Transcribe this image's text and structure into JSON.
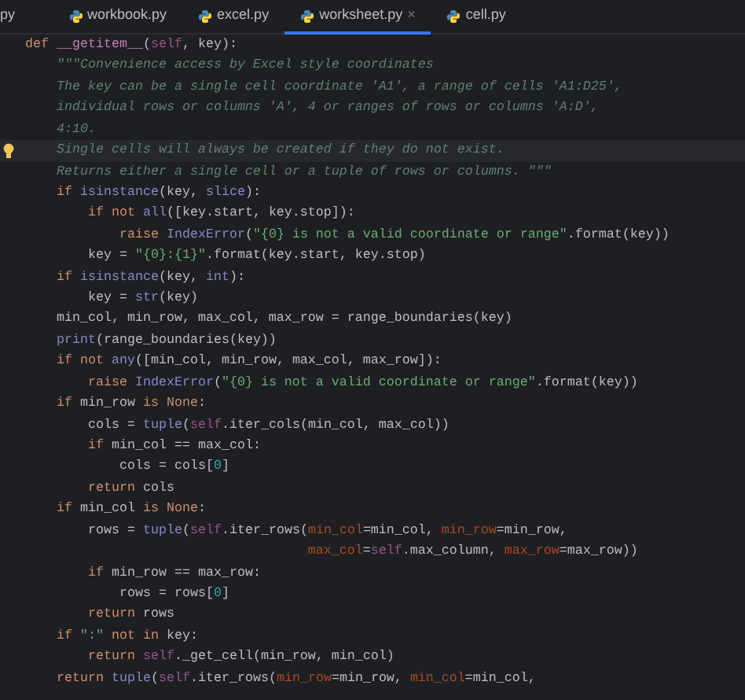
{
  "tabs": [
    {
      "label": "py",
      "selected": false
    },
    {
      "label": "workbook.py",
      "selected": false,
      "icon": true
    },
    {
      "label": "excel.py",
      "selected": false,
      "icon": true
    },
    {
      "label": "worksheet.py",
      "selected": true,
      "icon": true,
      "close": "×"
    },
    {
      "label": "cell.py",
      "selected": false,
      "icon": true
    }
  ],
  "editor": {
    "lines": [
      {
        "current": false,
        "hint": false,
        "tokens": [
          {
            "kind": "kw",
            "text": "def "
          },
          {
            "kind": "fn",
            "text": "__getitem__"
          },
          {
            "kind": "p",
            "text": "("
          },
          {
            "kind": "self",
            "text": "self"
          },
          {
            "kind": "p",
            "text": ", key):"
          }
        ]
      },
      {
        "current": false,
        "hint": false,
        "tokens": [
          {
            "kind": "doc",
            "text": "    \"\"\"Convenience access by Excel style coordinates"
          }
        ]
      },
      {
        "current": false,
        "hint": false,
        "tokens": [
          {
            "kind": "doc",
            "text": "    The key can be a single cell coordinate 'A1', a range of cells 'A1:D25',"
          }
        ]
      },
      {
        "current": false,
        "hint": false,
        "tokens": [
          {
            "kind": "doc",
            "text": "    individual rows or columns 'A', 4 or ranges of rows or columns 'A:D',"
          }
        ]
      },
      {
        "current": false,
        "hint": false,
        "tokens": [
          {
            "kind": "doc",
            "text": "    4:10."
          }
        ]
      },
      {
        "current": true,
        "hint": true,
        "tokens": [
          {
            "kind": "doc",
            "text": "    Single cells will always be created if they do not exist."
          }
        ]
      },
      {
        "current": false,
        "hint": false,
        "tokens": [
          {
            "kind": "doc",
            "text": "    Returns either a single cell or a tuple of rows or columns. \"\"\""
          }
        ]
      },
      {
        "current": false,
        "hint": false,
        "tokens": [
          {
            "kind": "kw",
            "text": "    if "
          },
          {
            "kind": "bi",
            "text": "isinstance"
          },
          {
            "kind": "p",
            "text": "(key, "
          },
          {
            "kind": "bi",
            "text": "slice"
          },
          {
            "kind": "p",
            "text": "):"
          }
        ]
      },
      {
        "current": false,
        "hint": false,
        "tokens": [
          {
            "kind": "kw",
            "text": "        if not "
          },
          {
            "kind": "bi",
            "text": "all"
          },
          {
            "kind": "p",
            "text": "([key.start, key.stop]):"
          }
        ]
      },
      {
        "current": false,
        "hint": false,
        "tokens": [
          {
            "kind": "kw",
            "text": "            raise "
          },
          {
            "kind": "bi",
            "text": "IndexError"
          },
          {
            "kind": "p",
            "text": "("
          },
          {
            "kind": "str",
            "text": "\"{0} is not a valid coordinate or range\""
          },
          {
            "kind": "p",
            "text": ".format(key))"
          }
        ]
      },
      {
        "current": false,
        "hint": false,
        "tokens": [
          {
            "kind": "p",
            "text": "        key = "
          },
          {
            "kind": "str",
            "text": "\"{0}:{1}\""
          },
          {
            "kind": "p",
            "text": ".format(key.start, key.stop)"
          }
        ]
      },
      {
        "current": false,
        "hint": false,
        "tokens": [
          {
            "kind": "kw",
            "text": "    if "
          },
          {
            "kind": "bi",
            "text": "isinstance"
          },
          {
            "kind": "p",
            "text": "(key, "
          },
          {
            "kind": "bi",
            "text": "int"
          },
          {
            "kind": "p",
            "text": "):"
          }
        ]
      },
      {
        "current": false,
        "hint": false,
        "tokens": [
          {
            "kind": "p",
            "text": "        key = "
          },
          {
            "kind": "bi",
            "text": "str"
          },
          {
            "kind": "p",
            "text": "(key)"
          }
        ]
      },
      {
        "current": false,
        "hint": false,
        "tokens": [
          {
            "kind": "p",
            "text": "    min_col, min_row, max_col, max_row = range_boundaries(key)"
          }
        ]
      },
      {
        "current": false,
        "hint": false,
        "tokens": [
          {
            "kind": "bi",
            "text": "    print"
          },
          {
            "kind": "p",
            "text": "(range_boundaries(key))"
          }
        ]
      },
      {
        "current": false,
        "hint": false,
        "tokens": [
          {
            "kind": "kw",
            "text": "    if not "
          },
          {
            "kind": "bi",
            "text": "any"
          },
          {
            "kind": "p",
            "text": "([min_col, min_row, max_col, max_row]):"
          }
        ]
      },
      {
        "current": false,
        "hint": false,
        "tokens": [
          {
            "kind": "kw",
            "text": "        raise "
          },
          {
            "kind": "bi",
            "text": "IndexError"
          },
          {
            "kind": "p",
            "text": "("
          },
          {
            "kind": "str",
            "text": "\"{0} is not a valid coordinate or range\""
          },
          {
            "kind": "p",
            "text": ".format(key))"
          }
        ]
      },
      {
        "current": false,
        "hint": false,
        "tokens": [
          {
            "kind": "kw",
            "text": "    if "
          },
          {
            "kind": "p",
            "text": "min_row "
          },
          {
            "kind": "kw",
            "text": "is None"
          },
          {
            "kind": "p",
            "text": ":"
          }
        ]
      },
      {
        "current": false,
        "hint": false,
        "tokens": [
          {
            "kind": "p",
            "text": "        cols = "
          },
          {
            "kind": "bi",
            "text": "tuple"
          },
          {
            "kind": "p",
            "text": "("
          },
          {
            "kind": "self",
            "text": "self"
          },
          {
            "kind": "p",
            "text": ".iter_cols(min_col, max_col))"
          }
        ]
      },
      {
        "current": false,
        "hint": false,
        "tokens": [
          {
            "kind": "kw",
            "text": "        if "
          },
          {
            "kind": "p",
            "text": "min_col == max_col:"
          }
        ]
      },
      {
        "current": false,
        "hint": false,
        "tokens": [
          {
            "kind": "p",
            "text": "            cols = cols["
          },
          {
            "kind": "num",
            "text": "0"
          },
          {
            "kind": "p",
            "text": "]"
          }
        ]
      },
      {
        "current": false,
        "hint": false,
        "tokens": [
          {
            "kind": "kw",
            "text": "        return "
          },
          {
            "kind": "p",
            "text": "cols"
          }
        ]
      },
      {
        "current": false,
        "hint": false,
        "tokens": [
          {
            "kind": "kw",
            "text": "    if "
          },
          {
            "kind": "p",
            "text": "min_col "
          },
          {
            "kind": "kw",
            "text": "is None"
          },
          {
            "kind": "p",
            "text": ":"
          }
        ]
      },
      {
        "current": false,
        "hint": false,
        "tokens": [
          {
            "kind": "p",
            "text": "        rows = "
          },
          {
            "kind": "bi",
            "text": "tuple"
          },
          {
            "kind": "p",
            "text": "("
          },
          {
            "kind": "self",
            "text": "self"
          },
          {
            "kind": "p",
            "text": ".iter_rows("
          },
          {
            "kind": "arg",
            "text": "min_col"
          },
          {
            "kind": "p",
            "text": "=min_col, "
          },
          {
            "kind": "arg",
            "text": "min_row"
          },
          {
            "kind": "p",
            "text": "=min_row,"
          }
        ]
      },
      {
        "current": false,
        "hint": false,
        "tokens": [
          {
            "kind": "arg",
            "text": "                                    max_col"
          },
          {
            "kind": "p",
            "text": "="
          },
          {
            "kind": "self",
            "text": "self"
          },
          {
            "kind": "p",
            "text": ".max_column, "
          },
          {
            "kind": "arg",
            "text": "max_row"
          },
          {
            "kind": "p",
            "text": "=max_row))"
          }
        ]
      },
      {
        "current": false,
        "hint": false,
        "tokens": [
          {
            "kind": "kw",
            "text": "        if "
          },
          {
            "kind": "p",
            "text": "min_row == max_row:"
          }
        ]
      },
      {
        "current": false,
        "hint": false,
        "tokens": [
          {
            "kind": "p",
            "text": "            rows = rows["
          },
          {
            "kind": "num",
            "text": "0"
          },
          {
            "kind": "p",
            "text": "]"
          }
        ]
      },
      {
        "current": false,
        "hint": false,
        "tokens": [
          {
            "kind": "kw",
            "text": "        return "
          },
          {
            "kind": "p",
            "text": "rows"
          }
        ]
      },
      {
        "current": false,
        "hint": false,
        "tokens": [
          {
            "kind": "kw",
            "text": "    if "
          },
          {
            "kind": "str",
            "text": "\":\""
          },
          {
            "kind": "kw",
            "text": " not in "
          },
          {
            "kind": "p",
            "text": "key:"
          }
        ]
      },
      {
        "current": false,
        "hint": false,
        "tokens": [
          {
            "kind": "kw",
            "text": "        return "
          },
          {
            "kind": "self",
            "text": "self"
          },
          {
            "kind": "p",
            "text": "._get_cell(min_row, min_col)"
          }
        ]
      },
      {
        "current": false,
        "hint": false,
        "tokens": [
          {
            "kind": "kw",
            "text": "    return "
          },
          {
            "kind": "bi",
            "text": "tuple"
          },
          {
            "kind": "p",
            "text": "("
          },
          {
            "kind": "self",
            "text": "self"
          },
          {
            "kind": "p",
            "text": ".iter_rows("
          },
          {
            "kind": "arg",
            "text": "min_row"
          },
          {
            "kind": "p",
            "text": "=min_row, "
          },
          {
            "kind": "arg",
            "text": "min_col"
          },
          {
            "kind": "p",
            "text": "=min_col,"
          }
        ]
      }
    ]
  }
}
